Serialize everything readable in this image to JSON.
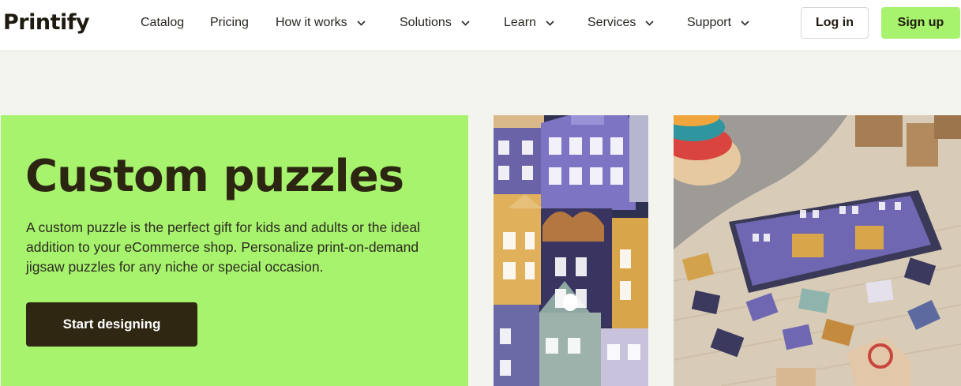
{
  "brand": {
    "logo_text": "Printify"
  },
  "nav": {
    "items": [
      {
        "label": "Catalog",
        "has_dropdown": false
      },
      {
        "label": "Pricing",
        "has_dropdown": false
      },
      {
        "label": "How it works",
        "has_dropdown": true
      },
      {
        "label": "Solutions",
        "has_dropdown": true
      },
      {
        "label": "Learn",
        "has_dropdown": true
      },
      {
        "label": "Services",
        "has_dropdown": true
      },
      {
        "label": "Support",
        "has_dropdown": true
      }
    ],
    "login_label": "Log in",
    "signup_label": "Sign up"
  },
  "hero": {
    "title": "Custom puzzles",
    "description": "A custom puzzle is the perfect gift for kids and adults or the ideal addition to your eCommerce shop. Personalize print-on-demand jigsaw puzzles for any niche or special occasion.",
    "cta_label": "Start designing"
  },
  "colors": {
    "accent_green": "#a7f36d",
    "dark_button": "#2f2712",
    "page_background": "#f4f4ef"
  },
  "icons": [
    "chevron-down-icon"
  ]
}
